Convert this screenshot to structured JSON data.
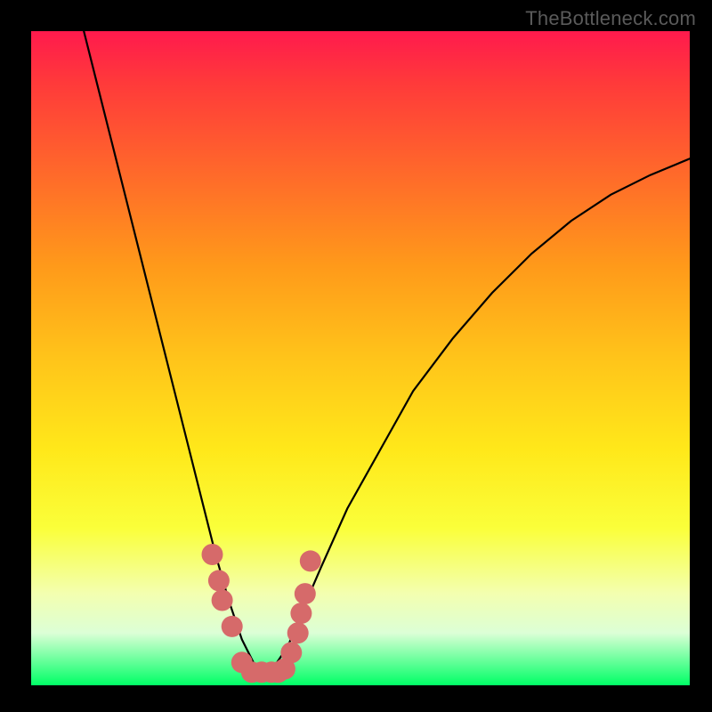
{
  "watermark": "TheBottleneck.com",
  "chart_data": {
    "type": "line",
    "title": "",
    "xlabel": "",
    "ylabel": "",
    "xlim": [
      0,
      100
    ],
    "ylim": [
      0,
      100
    ],
    "series": [
      {
        "name": "bottleneck-curve",
        "x": [
          8,
          10,
          12,
          14,
          16,
          18,
          20,
          22,
          24,
          26,
          28,
          30,
          32,
          34,
          35.5,
          37,
          39,
          41,
          44,
          48,
          53,
          58,
          64,
          70,
          76,
          82,
          88,
          94,
          100
        ],
        "values": [
          100,
          92,
          84,
          76,
          68,
          60,
          52,
          44,
          36,
          28,
          20,
          13,
          7,
          3,
          2,
          3,
          6,
          11,
          18,
          27,
          36,
          45,
          53,
          60,
          66,
          71,
          75,
          78,
          80.5
        ]
      }
    ],
    "markers": {
      "name": "highlight-dots",
      "color": "#d66a6a",
      "points": [
        {
          "x": 27.5,
          "y": 20
        },
        {
          "x": 28.5,
          "y": 16
        },
        {
          "x": 29.0,
          "y": 13
        },
        {
          "x": 30.5,
          "y": 9
        },
        {
          "x": 32.0,
          "y": 3.5
        },
        {
          "x": 33.5,
          "y": 2.0
        },
        {
          "x": 35.0,
          "y": 2.0
        },
        {
          "x": 36.5,
          "y": 2.0
        },
        {
          "x": 37.5,
          "y": 2.0
        },
        {
          "x": 38.5,
          "y": 2.5
        },
        {
          "x": 39.5,
          "y": 5.0
        },
        {
          "x": 40.5,
          "y": 8.0
        },
        {
          "x": 41.0,
          "y": 11.0
        },
        {
          "x": 41.6,
          "y": 14.0
        },
        {
          "x": 42.4,
          "y": 19.0
        }
      ]
    }
  }
}
